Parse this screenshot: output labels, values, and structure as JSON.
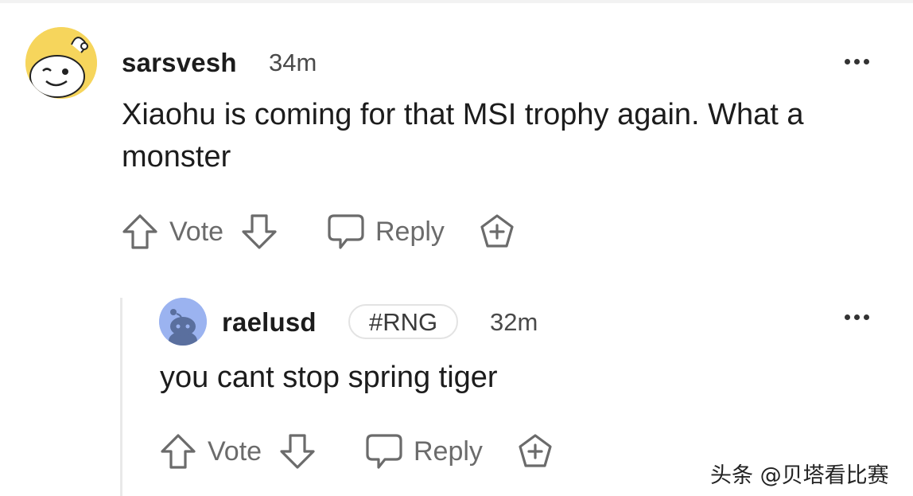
{
  "comments": [
    {
      "username": "sarsvesh",
      "time": "34m",
      "body": "Xiaohu is coming for that MSI trophy again. What a monster",
      "actions": {
        "upvote_icon": "arrow-up-outline-icon",
        "vote_label": "Vote",
        "downvote_icon": "arrow-down-outline-icon",
        "reply_icon": "speech-bubble-icon",
        "reply_label": "Reply",
        "award_icon": "plus-pentagon-icon"
      },
      "more_icon": "ellipsis-horizontal-icon"
    },
    {
      "username": "raelusd",
      "flair": "#RNG",
      "time": "32m",
      "body": "you cant stop spring tiger",
      "actions": {
        "upvote_icon": "arrow-up-outline-icon",
        "vote_label": "Vote",
        "downvote_icon": "arrow-down-outline-icon",
        "reply_icon": "speech-bubble-icon",
        "reply_label": "Reply",
        "award_icon": "plus-pentagon-icon"
      },
      "more_icon": "ellipsis-horizontal-icon"
    }
  ],
  "watermark": {
    "text": "头条 @贝塔看比赛"
  },
  "colors": {
    "avatar_yellow": "#f6d55c",
    "avatar_blue": "#9bb3f0",
    "action_gray": "#6b6b6b",
    "text": "#1c1c1c"
  }
}
